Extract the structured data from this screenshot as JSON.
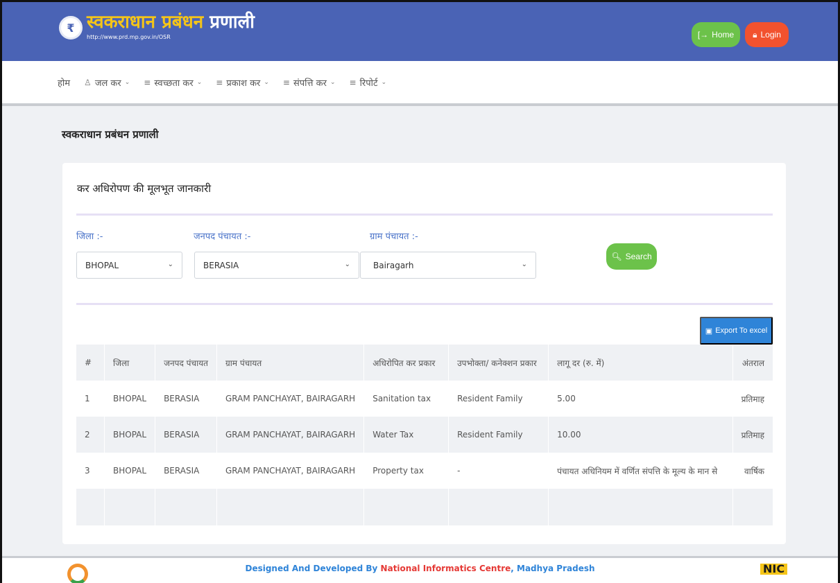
{
  "header": {
    "brand_part1": "स्वकराधान प्रबंधन",
    "brand_part2": "प्रणाली",
    "url": "http://www.prd.mp.gov.in/OSR",
    "home_label": "Home",
    "login_label": "Login",
    "colors": {
      "bar": "#4a63b5",
      "home": "#6cc24a",
      "login": "#f2522e",
      "brand_yellow": "#f5c518"
    }
  },
  "nav": {
    "items": [
      {
        "label": "होम",
        "icon": "",
        "dropdown": false
      },
      {
        "label": "जल कर",
        "icon": "user-icon",
        "dropdown": true
      },
      {
        "label": "स्वच्छता कर",
        "icon": "list-icon",
        "dropdown": true
      },
      {
        "label": "प्रकाश कर",
        "icon": "list-icon",
        "dropdown": true
      },
      {
        "label": "संपत्ति कर",
        "icon": "list-icon",
        "dropdown": true
      },
      {
        "label": "रिपोर्ट",
        "icon": "list-icon",
        "dropdown": true
      }
    ]
  },
  "page": {
    "title": "स्वकराधान प्रबंधन प्रणाली",
    "card_heading": "कर अधिरोपण की मूलभूत जानकारी"
  },
  "filters": {
    "district_label": "जिला :-",
    "district_value": "BHOPAL",
    "janpad_label": "जनपद पंचायत :-",
    "janpad_value": "BERASIA",
    "gram_label": "ग्राम पंचायत :-",
    "gram_value": "Bairagarh",
    "search_label": "Search"
  },
  "export_label": "Export To excel",
  "table": {
    "headers": [
      "#",
      "जिला",
      "जनपद पंचायत",
      "ग्राम पंचायत",
      "अधिरोपित कर प्रकार",
      "उपभोक्ता/ कनेक्शन प्रकार",
      "लागू दर (रु. में)",
      "अंतराल"
    ],
    "rows": [
      [
        "1",
        "BHOPAL",
        "BERASIA",
        "GRAM PANCHAYAT, BAIRAGARH",
        "Sanitation tax",
        "Resident Family",
        "5.00",
        "प्रतिमाह"
      ],
      [
        "2",
        "BHOPAL",
        "BERASIA",
        "GRAM PANCHAYAT, BAIRAGARH",
        "Water Tax",
        "Resident Family",
        "10.00",
        "प्रतिमाह"
      ],
      [
        "3",
        "BHOPAL",
        "BERASIA",
        "GRAM PANCHAYAT, BAIRAGARH",
        "Property tax",
        "-",
        "पंचायत अधिनियम में वर्णित संपत्ति के मूल्य के मान से",
        "वार्षिक"
      ]
    ]
  },
  "footer": {
    "text_prefix": "Designed And Developed By ",
    "org": "National Informatics Centre",
    "text_suffix": ", Madhya Pradesh",
    "logo_right": "NIC"
  }
}
